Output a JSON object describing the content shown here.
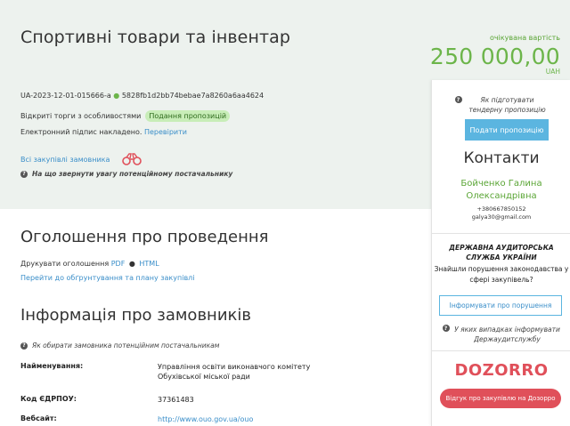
{
  "header": {
    "title": "Спортивні товари та інвентар",
    "expected_value_caption": "очікувана вартість",
    "expected_value": "250 000,00",
    "currency": "UAH"
  },
  "tender": {
    "id": "UA-2023-12-01-015666-a",
    "hash": "5828fb1d2bb74bebae7a8260a6aa4624",
    "procedure": "Відкриті торги з особливостями",
    "status": "Подання пропозицій",
    "signature_text": "Електронний підпис накладено.",
    "verify_link": "Перевірити",
    "all_purchases_link": "Всі закупівлі замовника",
    "attention_hint": "На що звернути увагу потенційному постачальнику"
  },
  "announcement": {
    "heading": "Оголошення про проведення",
    "print_label": "Друкувати оголошення",
    "pdf_link": "PDF",
    "separator": "●",
    "html_link": "HTML",
    "plan_link": "Перейти до обґрунтування та плану закупівлі"
  },
  "customers": {
    "heading": "Інформація про замовників",
    "hint": "Як обирати замовника потенційним постачальникам",
    "name_label": "Найменування:",
    "name_value": "Управління освіти виконавчого комітету Обухівської міської ради",
    "code_label": "Код ЄДРПОУ:",
    "code_value": "37361483",
    "site_label": "Вебсайт:",
    "site_value": "http://www.ouo.gov.ua/ouo"
  },
  "sidebar": {
    "prepare_hint": "Як підготувати тендерну пропозицію",
    "submit_button": "Подати пропозицію",
    "contacts_title": "Контакти",
    "contact_name": "Бойченко Галина Олександрівна",
    "contact_phone": "+380667850152",
    "contact_email": "galya30@gmail.com",
    "audit_title": "ДЕРЖАВНА АУДИТОРСЬКА СЛУЖБА УКРАЇНИ",
    "audit_text": "Знайшли порушення законодавства у сфері закупівель?",
    "audit_button": "Інформувати про порушення",
    "audit_hint": "У яких випадках інформувати Держаудитслужбу",
    "dozorro_logo": "DOZORRO",
    "dozorro_button": "Відгук про закупівлю на Дозорро"
  },
  "colors": {
    "band_bg": "#edf2ee",
    "accent_green": "#6cb54a",
    "link_blue": "#3a8ec9",
    "button_blue": "#5bb5e0",
    "dozorro_red": "#e0505a",
    "badge_bg": "#c8edb8"
  },
  "icons": {
    "question": "question-circle-icon",
    "binoculars": "binoculars-icon"
  }
}
